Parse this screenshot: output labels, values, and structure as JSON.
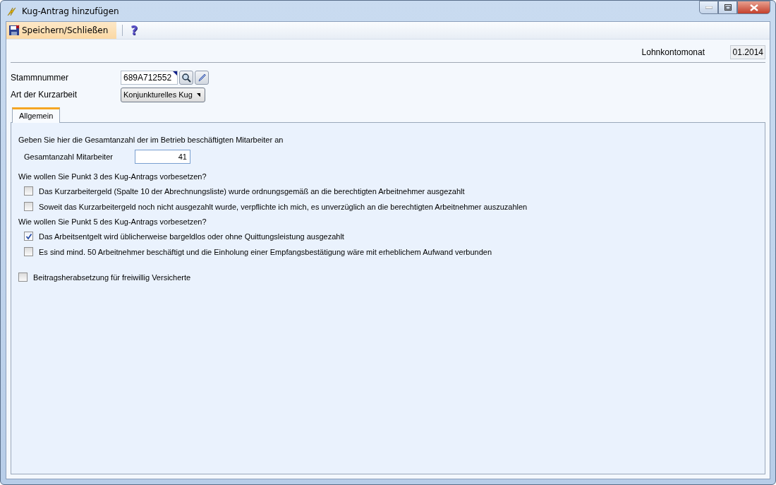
{
  "window": {
    "title": "Kug-Antrag hinzufügen"
  },
  "toolbar": {
    "save_button": "Speichern/Schließen",
    "help_button": "?"
  },
  "header": {
    "month_label": "Lohnkontomonat",
    "month_value": "01.2014"
  },
  "form": {
    "stammnummer_label": "Stammnummer",
    "stammnummer_value": "689A712552",
    "art_label": "Art der Kurzarbeit",
    "art_value": "Konjunkturelles Kug"
  },
  "tabs": [
    {
      "label": "Allgemein",
      "selected": true
    }
  ],
  "panel": {
    "intro": "Geben Sie hier die Gesamtanzahl der im Betrieb beschäftigten Mitarbeiter an",
    "count_label": "Gesamtanzahl Mitarbeiter",
    "count_value": "41",
    "sections": [
      {
        "heading": "Wie wollen Sie Punkt 3 des Kug-Antrags vorbesetzen?",
        "options": [
          {
            "label": "Das Kurzarbeitergeld (Spalte 10 der Abrechnungsliste) wurde ordnungsgemäß an die berechtigten Arbeitnehmer ausgezahlt",
            "checked": false
          },
          {
            "label": "Soweit das Kurzarbeitergeld noch nicht ausgezahlt wurde, verpflichte ich mich, es unverzüglich an die berechtigten Arbeitnehmer auszuzahlen",
            "checked": false
          }
        ]
      },
      {
        "heading": "Wie wollen Sie Punkt 5 des Kug-Antrags vorbesetzen?",
        "options": [
          {
            "label": "Das Arbeitsentgelt wird üblicherweise bargeldlos oder ohne Quittungsleistung ausgezahlt",
            "checked": true
          },
          {
            "label": "Es sind mind. 50 Arbeitnehmer beschäftigt und die Einholung einer Empfangsbestätigung wäre mit erheblichem Aufwand verbunden",
            "checked": false
          }
        ]
      }
    ],
    "extra_option": {
      "label": "Beitragsherabsetzung für freiwillig Versicherte",
      "checked": false
    }
  }
}
